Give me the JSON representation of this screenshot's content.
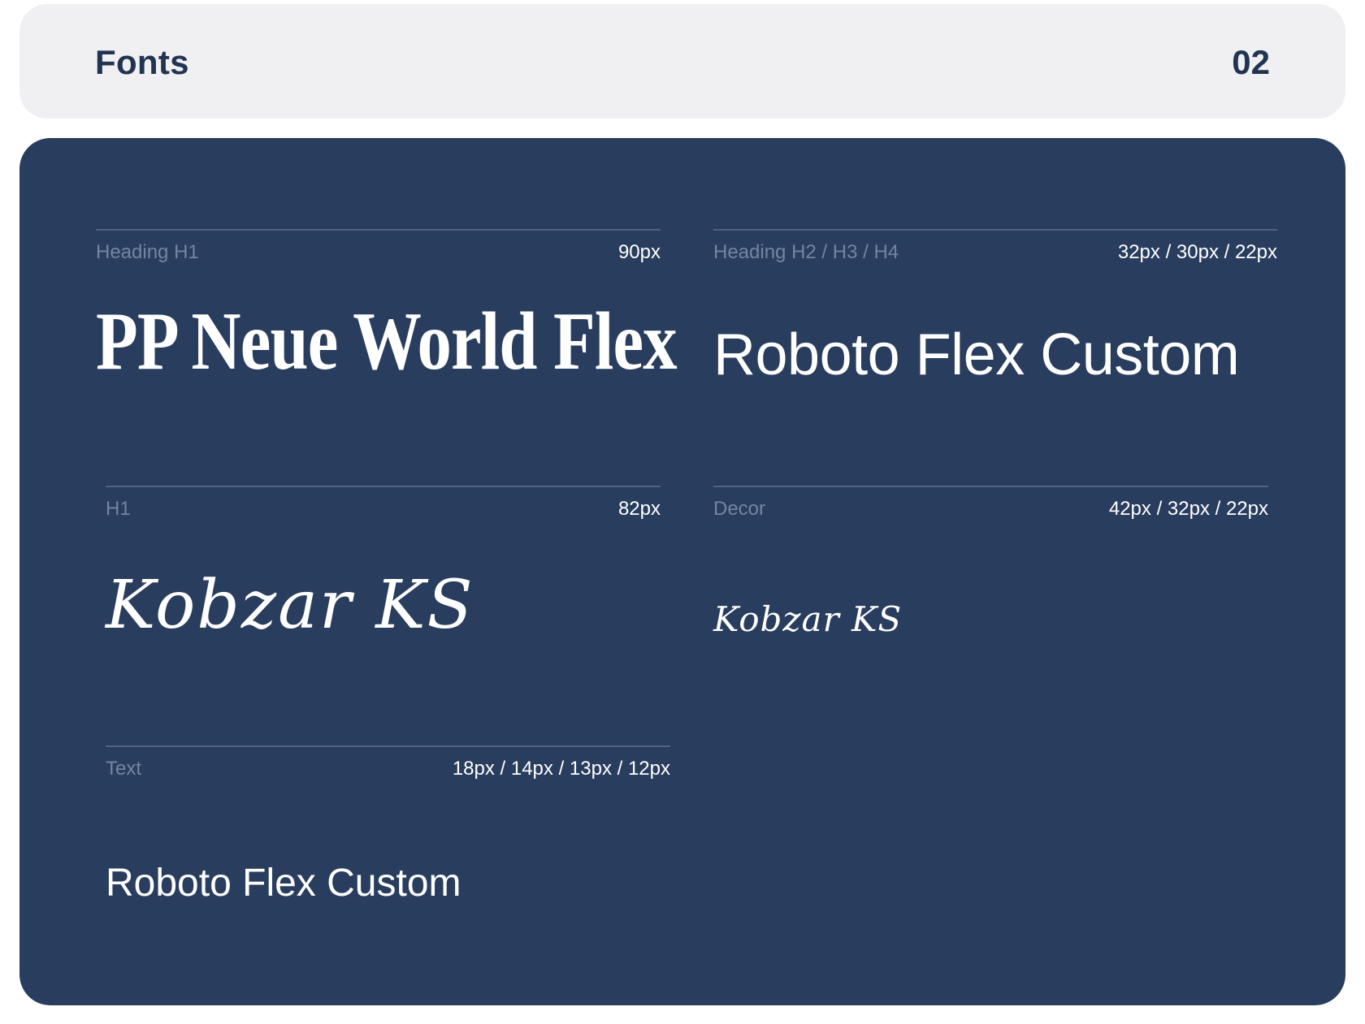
{
  "header": {
    "title": "Fonts",
    "number": "02"
  },
  "fonts": [
    {
      "label": "Heading H1",
      "sizes": "90px",
      "sample": "PP Neue World Flex"
    },
    {
      "label": "Heading H2 / H3 / H4",
      "sizes": "32px / 30px / 22px",
      "sample": "Roboto Flex Custom"
    },
    {
      "label": "H1",
      "sizes": "82px",
      "sample": "Kobzar KS"
    },
    {
      "label": "Decor",
      "sizes": "42px / 32px / 22px",
      "sample": "Kobzar KS"
    },
    {
      "label": "Text",
      "sizes": "18px / 14px / 13px / 12px",
      "sample": "Roboto Flex Custom"
    }
  ],
  "colors": {
    "header_bg": "#f0f0f2",
    "header_text": "#213452",
    "panel_bg": "#293d5e",
    "divider": "#4f6282",
    "label_text": "#7485a3",
    "value_text": "#ffffff"
  }
}
